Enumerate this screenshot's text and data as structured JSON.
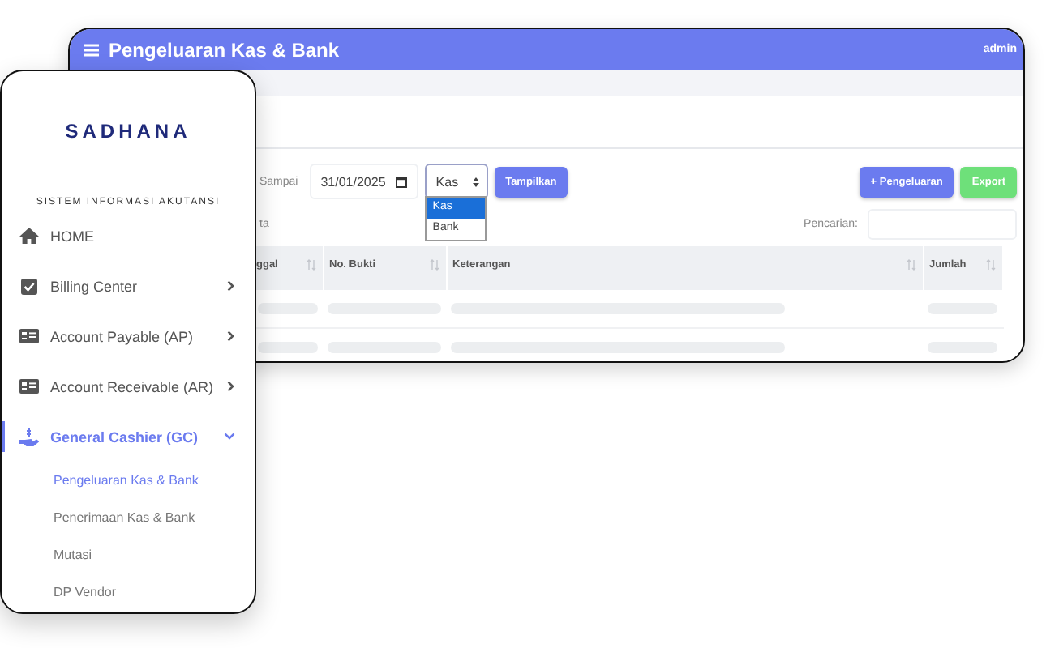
{
  "main_window": {
    "title": "Pengeluaran Kas & Bank",
    "user": "admin",
    "filter": {
      "label": "Sampai",
      "date": "31/01/2025",
      "select": {
        "value": "Kas",
        "expanded": true,
        "options": [
          {
            "label": "Kas",
            "selected": true
          },
          {
            "label": "Bank",
            "selected": false
          }
        ]
      },
      "show_button": "Tampilkan"
    },
    "actions": [
      {
        "label": "+ Pengeluaran",
        "kind": "primary"
      },
      {
        "label": "Export",
        "kind": "success"
      }
    ],
    "data_info": "ta",
    "search": {
      "label": "Pencarian:"
    },
    "table": {
      "columns": [
        "ggal",
        "No. Bukti",
        "Keterangan",
        "Jumlah"
      ]
    }
  },
  "sidebar": {
    "logo": "SADHANA",
    "subtitle": "SISTEM INFORMASI AKUTANSI",
    "items": [
      {
        "label": "HOME",
        "kind": "home",
        "selected": false
      },
      {
        "label": "Billing Center",
        "kind": "check",
        "selected": false,
        "expanded": false
      },
      {
        "label": "Account Payable (AP)",
        "kind": "card",
        "selected": false,
        "expanded": false
      },
      {
        "label": "Account Receivable (AR)",
        "kind": "card",
        "selected": false,
        "expanded": false
      },
      {
        "label": "General Cashier (GC)",
        "kind": "cash",
        "selected": true,
        "expanded": true,
        "children": [
          {
            "label": "Pengeluaran Kas & Bank",
            "selected": true
          },
          {
            "label": "Penerimaan Kas & Bank",
            "selected": false
          },
          {
            "label": "Mutasi",
            "selected": false
          },
          {
            "label": "DP Vendor",
            "selected": false
          }
        ]
      }
    ]
  }
}
